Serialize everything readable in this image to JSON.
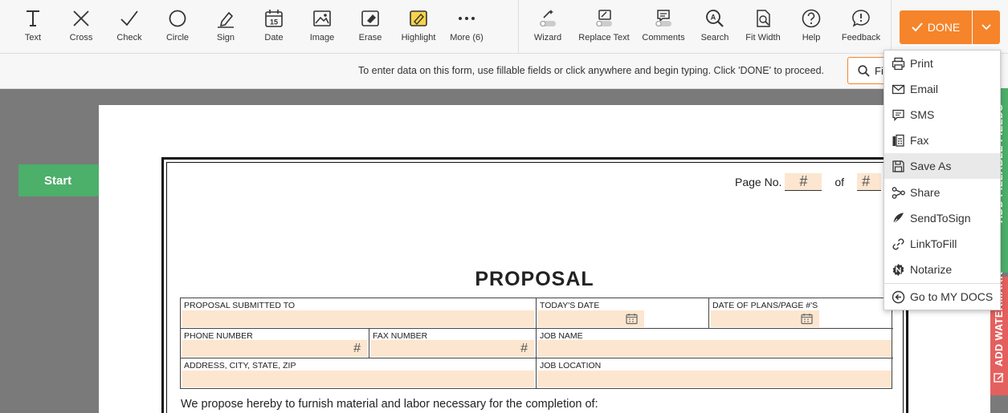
{
  "toolbar": {
    "tools": [
      {
        "id": "text",
        "label": "Text"
      },
      {
        "id": "cross",
        "label": "Cross"
      },
      {
        "id": "check",
        "label": "Check"
      },
      {
        "id": "circle",
        "label": "Circle"
      },
      {
        "id": "sign",
        "label": "Sign"
      },
      {
        "id": "date",
        "label": "Date"
      },
      {
        "id": "image",
        "label": "Image"
      },
      {
        "id": "erase",
        "label": "Erase"
      },
      {
        "id": "highlight",
        "label": "Highlight"
      },
      {
        "id": "more",
        "label": "More (6)"
      },
      {
        "id": "wizard",
        "label": "Wizard"
      },
      {
        "id": "replace-text",
        "label": "Replace Text"
      },
      {
        "id": "comments",
        "label": "Comments"
      },
      {
        "id": "search",
        "label": "Search"
      },
      {
        "id": "fit-width",
        "label": "Fit Width"
      },
      {
        "id": "help",
        "label": "Help"
      },
      {
        "id": "feedback",
        "label": "Feedback"
      }
    ],
    "date_icon_day": "15",
    "done_label": "DONE",
    "accent": "#f5842b"
  },
  "infobar": {
    "message": "To enter data on this form, use fillable fields or click anywhere and begin typing. Click 'DONE' to proceed.",
    "find_label": "Fi"
  },
  "start_label": "Start",
  "document": {
    "page_no_label": "Page No.",
    "of_label": "of",
    "hash": "#",
    "title": "PROPOSAL",
    "fields": {
      "submitted_to": "PROPOSAL SUBMITTED TO",
      "todays_date": "TODAY'S DATE",
      "date_of_plans": "DATE OF PLANS/PAGE #'S",
      "phone": "PHONE NUMBER",
      "fax": "FAX NUMBER",
      "job_name": "JOB NAME",
      "address": "ADDRESS, CITY, STATE, ZIP",
      "job_location": "JOB LOCATION"
    },
    "body_text": "We propose hereby to furnish material and labor necessary for the completion of:",
    "field_fill_color": "#fde6cf"
  },
  "side_tabs": {
    "green_label": "ADD FILLABLE FIELDS",
    "red_label": "ADD WATERMARK",
    "green_color": "#4caf6a",
    "red_color": "#e4605e"
  },
  "menu": {
    "items": [
      {
        "id": "print",
        "label": "Print"
      },
      {
        "id": "email",
        "label": "Email"
      },
      {
        "id": "sms",
        "label": "SMS"
      },
      {
        "id": "fax",
        "label": "Fax"
      },
      {
        "id": "save-as",
        "label": "Save As"
      },
      {
        "id": "share",
        "label": "Share"
      },
      {
        "id": "sendtosign",
        "label": "SendToSign"
      },
      {
        "id": "linktofill",
        "label": "LinkToFill"
      },
      {
        "id": "notarize",
        "label": "Notarize"
      },
      {
        "id": "go-to-my-docs",
        "label": "Go to MY DOCS"
      }
    ]
  }
}
